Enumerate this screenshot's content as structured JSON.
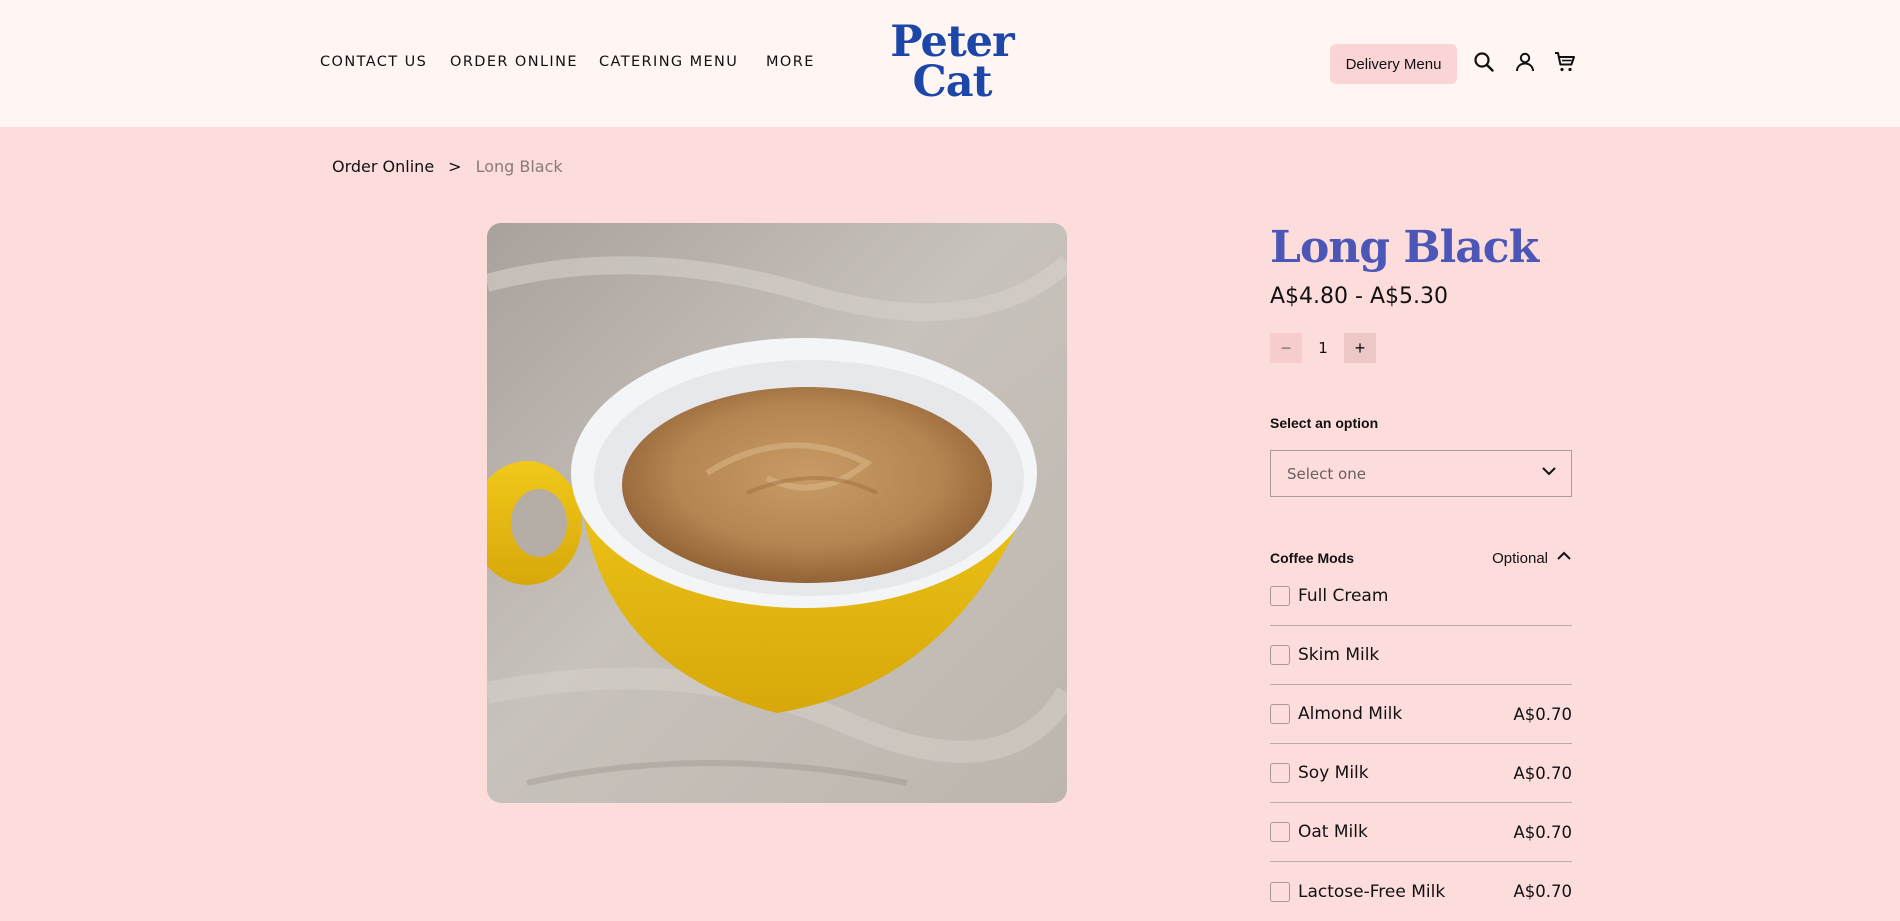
{
  "header": {
    "nav": [
      "CONTACT US",
      "ORDER ONLINE",
      "CATERING MENU",
      "MORE"
    ],
    "logo_line1": "Peter",
    "logo_line2": "Cat",
    "delivery_button": "Delivery Menu",
    "icons": [
      "search-icon",
      "account-icon",
      "cart-icon"
    ]
  },
  "breadcrumb": {
    "parent": "Order Online",
    "separator": ">",
    "current": "Long Black"
  },
  "product": {
    "title": "Long Black",
    "price": "A$4.80 - A$5.30",
    "quantity": "1",
    "quantity_minus": "−",
    "quantity_plus": "+",
    "option_label": "Select an option",
    "option_placeholder": "Select one",
    "image_alt": "Long black coffee in a yellow cup"
  },
  "coffee_mods": {
    "title": "Coffee Mods",
    "optional_label": "Optional",
    "items": [
      {
        "label": "Full Cream",
        "price": ""
      },
      {
        "label": "Skim Milk",
        "price": ""
      },
      {
        "label": "Almond Milk",
        "price": "A$0.70"
      },
      {
        "label": "Soy Milk",
        "price": "A$0.70"
      },
      {
        "label": "Oat Milk",
        "price": "A$0.70"
      },
      {
        "label": "Lactose-Free Milk",
        "price": "A$0.70"
      }
    ]
  },
  "colors": {
    "page_bg": "#fddcdc",
    "header_bg": "#fff5f3",
    "logo": "#1c47a8",
    "title": "#4b56b7",
    "button_bg": "#fbd5d5"
  }
}
